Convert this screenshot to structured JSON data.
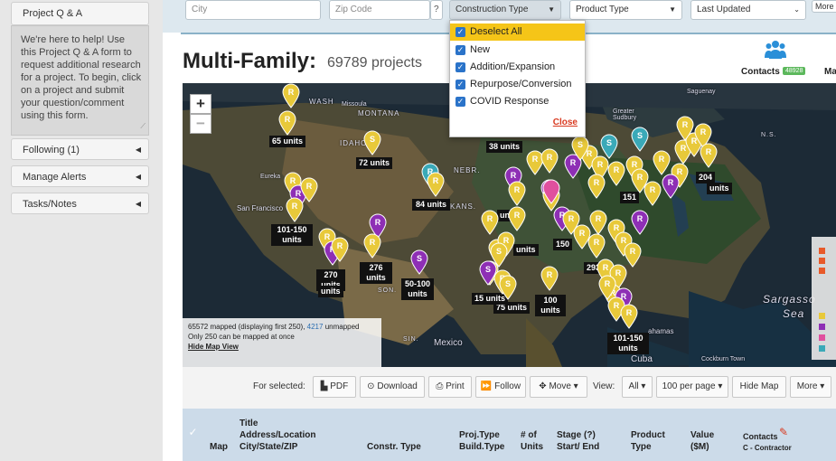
{
  "sidebar": {
    "project_qa": "Project Q & A",
    "help_text": "We're here to help! Use this Project Q & A form to request additional research for a project. To begin, click on a project and submit your question/comment using this form.",
    "items": [
      {
        "label": "Following (1)"
      },
      {
        "label": "Manage Alerts"
      },
      {
        "label": "Tasks/Notes"
      }
    ]
  },
  "filters": {
    "city_placeholder": "City",
    "zip_placeholder": "Zip Code",
    "help_glyph": "?",
    "construction_type": "Construction Type",
    "product_type": "Product Type",
    "last_updated": "Last Updated",
    "more": "More"
  },
  "header": {
    "title": "Multi-Family:",
    "count": "69789 projects",
    "contacts_label": "Contacts",
    "contacts_count": "48928",
    "ma": "Ma"
  },
  "construction_menu": {
    "options": [
      {
        "label": "Deselect All",
        "checked": true,
        "highlighted": true
      },
      {
        "label": "New",
        "checked": true
      },
      {
        "label": "Addition/Expansion",
        "checked": true
      },
      {
        "label": "Repurpose/Conversion",
        "checked": true
      },
      {
        "label": "COVID Response",
        "checked": true
      }
    ],
    "close": "Close"
  },
  "map": {
    "zoom_in": "+",
    "zoom_out": "−",
    "mapped_text": "65572 mapped (displaying first 250),",
    "unmapped_count": "4217",
    "unmapped_text": "unmapped",
    "limit_text": "Only 250 can be mapped at once",
    "hide_map_view": "Hide Map View",
    "places": {
      "montana": "MONTANA",
      "idaho": "IDAHO",
      "nebr": "NEBR.",
      "kans": "KANS.",
      "mexico": "Mexico",
      "cuba": "Cuba",
      "sargasso": "Sargasso",
      "sea": "Sea",
      "san_francisco": "San Francisco",
      "eureka": "Eureka",
      "saguenay": "Saguenay",
      "greater_sudbury": "Greater Sudbury",
      "ns": "N.S.",
      "missoula": "Missoula",
      "cockburn_town": "Cockburn Town",
      "bahamas": "ahamas",
      "wash": "WASH",
      "sin": "SIN.",
      "son": "SON."
    },
    "labels": [
      "65 units",
      "72 units",
      "84 units",
      "101-150 units",
      "276 units",
      "50-100 units",
      "270 units",
      "100 units",
      "75 units",
      "101-150 units",
      "38 units",
      "151",
      "204",
      "150",
      "293",
      "15 units",
      "units",
      "units",
      "units",
      "units"
    ],
    "pin_letter": "R",
    "pin_letter_s": "S"
  },
  "toolbar": {
    "for_selected": "For selected:",
    "pdf": "PDF",
    "download": "Download",
    "print": "Print",
    "follow": "Follow",
    "move": "Move",
    "view_label": "View:",
    "all": "All",
    "per_page": "100 per page",
    "hide_map": "Hide Map",
    "more": "More"
  },
  "table": {
    "headers": {
      "map": "Map",
      "title": "Title",
      "address": "Address/Location",
      "city": "City/State/ZIP",
      "constr_type": "Constr. Type",
      "proj_type": "Proj.Type",
      "build_type": "Build.Type",
      "num": "# of",
      "units": "Units",
      "stage": "Stage (?)",
      "start_end": "Start/ End",
      "product": "Product",
      "type": "Type",
      "value": "Value",
      "sm": "($M)",
      "contacts": "Contacts",
      "contractor": "C - Contractor"
    }
  },
  "colors": {
    "pin_yellow": "#e8c93a",
    "pin_purple": "#8e2fb5",
    "pin_pink": "#e0509e",
    "pin_teal": "#3aa9b8",
    "menu_highlight": "#f5c518",
    "checkbox": "#2a73c9"
  }
}
